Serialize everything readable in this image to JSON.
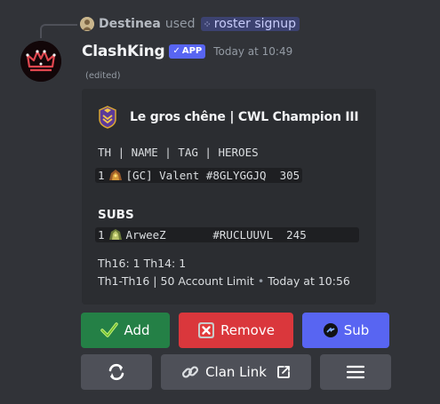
{
  "reply": {
    "username": "Destinea",
    "used_text": "used",
    "command": "roster signup"
  },
  "message": {
    "bot_name": "ClashKing",
    "app_tag": "APP",
    "timestamp": "Today at 10:49",
    "edited": "(edited)"
  },
  "embed": {
    "title": "Le gros chêne | CWL Champion III",
    "table_header": "TH | NAME | TAG | HEROES",
    "main_rows": [
      {
        "num": "1",
        "text": "[GC] Valent #8GLYGGJQ  305"
      }
    ],
    "subs_title": "SUBS",
    "sub_rows": [
      {
        "num": "1",
        "text": "ArweeZ       #RUCLUUVL  245"
      }
    ],
    "th_counts": "Th16: 1 Th14: 1",
    "footer_text": "Th1-Th16 | 50 Account Limit",
    "footer_time": "Today at 10:56"
  },
  "buttons": {
    "add": "Add",
    "remove": "Remove",
    "sub": "Sub",
    "clan_link": "Clan Link"
  },
  "colors": {
    "green": "#248046",
    "red": "#da373c",
    "blurple": "#5865f2",
    "grey": "#4e5058"
  }
}
